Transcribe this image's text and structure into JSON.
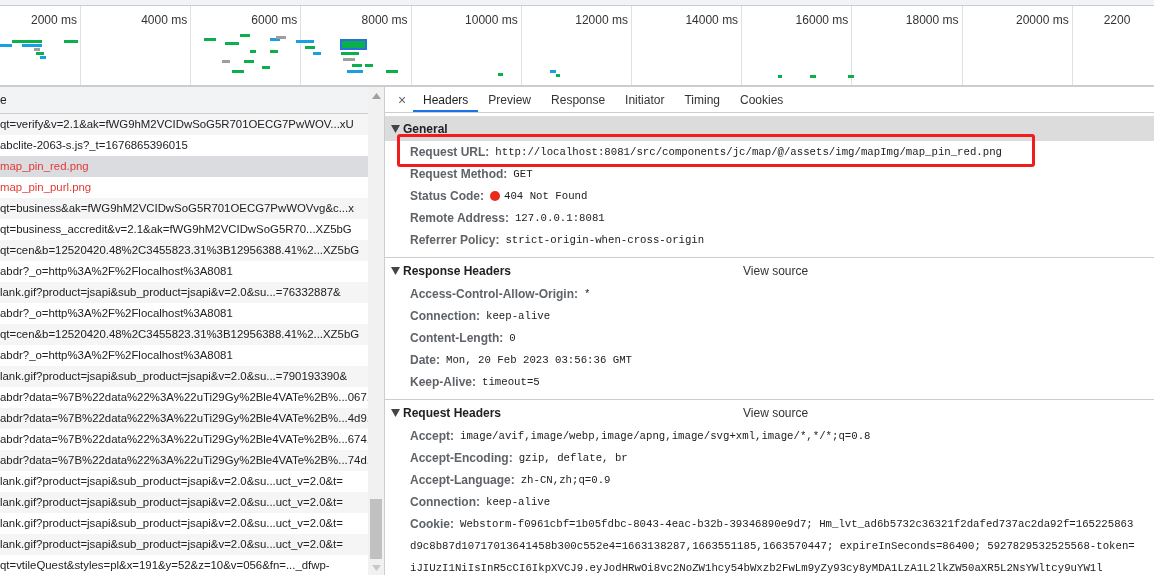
{
  "timeline": {
    "ticks": [
      "2000 ms",
      "4000 ms",
      "6000 ms",
      "8000 ms",
      "10000 ms",
      "12000 ms",
      "14000 ms",
      "16000 ms",
      "18000 ms",
      "20000 ms",
      "2200"
    ]
  },
  "request_list": {
    "column_header": "e",
    "rows": [
      {
        "name": "qt=verify&v=2.1&ak=fWG9hM2VCIDwSoG5R701OECG7PwWOV...xU",
        "selected": false,
        "failed": false
      },
      {
        "name": "abclite-2063-s.js?_t=1676865396015",
        "selected": false,
        "failed": false
      },
      {
        "name": "map_pin_red.png",
        "selected": true,
        "failed": true
      },
      {
        "name": "map_pin_purl.png",
        "selected": false,
        "failed": true
      },
      {
        "name": "qt=business&ak=fWG9hM2VCIDwSoG5R701OECG7PwWOVvg&c...x",
        "selected": false,
        "failed": false
      },
      {
        "name": "qt=business_accredit&v=2.1&ak=fWG9hM2VCIDwSoG5R70...XZ5bG",
        "selected": false,
        "failed": false
      },
      {
        "name": "qt=cen&b=12520420.48%2C3455823.31%3B12956388.41%2...XZ5bG",
        "selected": false,
        "failed": false
      },
      {
        "name": "abdr?_o=http%3A%2F%2Flocalhost%3A8081",
        "selected": false,
        "failed": false
      },
      {
        "name": "lank.gif?product=jsapi&sub_product=jsapi&v=2.0&su...=76332887&",
        "selected": false,
        "failed": false
      },
      {
        "name": "abdr?_o=http%3A%2F%2Flocalhost%3A8081",
        "selected": false,
        "failed": false
      },
      {
        "name": "qt=cen&b=12520420.48%2C3455823.31%3B12956388.41%2...XZ5bG",
        "selected": false,
        "failed": false
      },
      {
        "name": "abdr?_o=http%3A%2F%2Flocalhost%3A8081",
        "selected": false,
        "failed": false
      },
      {
        "name": "lank.gif?product=jsapi&sub_product=jsapi&v=2.0&su...=790193390&",
        "selected": false,
        "failed": false
      },
      {
        "name": "abdr?data=%7B%22data%22%3A%22uTi29Gy%2Ble4VATe%2B%...067.",
        "selected": false,
        "failed": false
      },
      {
        "name": "abdr?data=%7B%22data%22%3A%22uTi29Gy%2Ble4VATe%2B%...4d9.",
        "selected": false,
        "failed": false
      },
      {
        "name": "abdr?data=%7B%22data%22%3A%22uTi29Gy%2Ble4VATe%2B%...674.",
        "selected": false,
        "failed": false
      },
      {
        "name": "abdr?data=%7B%22data%22%3A%22uTi29Gy%2Ble4VATe%2B%...74d.",
        "selected": false,
        "failed": false
      },
      {
        "name": "lank.gif?product=jsapi&sub_product=jsapi&v=2.0&su...uct_v=2.0&t=",
        "selected": false,
        "failed": false
      },
      {
        "name": "lank.gif?product=jsapi&sub_product=jsapi&v=2.0&su...uct_v=2.0&t=",
        "selected": false,
        "failed": false
      },
      {
        "name": "lank.gif?product=jsapi&sub_product=jsapi&v=2.0&su...uct_v=2.0&t=",
        "selected": false,
        "failed": false
      },
      {
        "name": "lank.gif?product=jsapi&sub_product=jsapi&v=2.0&su...uct_v=2.0&t=",
        "selected": false,
        "failed": false
      },
      {
        "name": "qt=vtileQuest&styles=pl&x=191&y=52&z=10&v=056&fn=..._dfwp-",
        "selected": false,
        "failed": false
      }
    ]
  },
  "details": {
    "close_label": "×",
    "tabs": [
      {
        "label": "Headers",
        "selected": true
      },
      {
        "label": "Preview",
        "selected": false
      },
      {
        "label": "Response",
        "selected": false
      },
      {
        "label": "Initiator",
        "selected": false
      },
      {
        "label": "Timing",
        "selected": false
      },
      {
        "label": "Cookies",
        "selected": false
      }
    ],
    "sections": [
      {
        "title": "General",
        "rows": [
          {
            "label": "Request URL:",
            "value": "http://localhost:8081/src/components/jc/map/@/assets/img/mapImg/map_pin_red.png",
            "highlighted": true
          },
          {
            "label": "Request Method:",
            "value": "GET"
          },
          {
            "label": "Status Code:",
            "value": "404 Not Found",
            "error": true
          },
          {
            "label": "Remote Address:",
            "value": "127.0.0.1:8081"
          },
          {
            "label": "Referrer Policy:",
            "value": "strict-origin-when-cross-origin"
          }
        ]
      },
      {
        "title": "Response Headers",
        "view_source": "View source",
        "rows": [
          {
            "label": "Access-Control-Allow-Origin:",
            "value": "*"
          },
          {
            "label": "Connection:",
            "value": "keep-alive"
          },
          {
            "label": "Content-Length:",
            "value": "0"
          },
          {
            "label": "Date:",
            "value": "Mon, 20 Feb 2023 03:56:36 GMT"
          },
          {
            "label": "Keep-Alive:",
            "value": "timeout=5"
          }
        ]
      },
      {
        "title": "Request Headers",
        "view_source": "View source",
        "rows": [
          {
            "label": "Accept:",
            "value": "image/avif,image/webp,image/apng,image/svg+xml,image/*,*/*;q=0.8"
          },
          {
            "label": "Accept-Encoding:",
            "value": "gzip, deflate, br"
          },
          {
            "label": "Accept-Language:",
            "value": "zh-CN,zh;q=0.9"
          },
          {
            "label": "Connection:",
            "value": "keep-alive"
          },
          {
            "label": "Cookie:",
            "value": "Webstorm-f0961cbf=1b05fdbc-8043-4eac-b32b-39346890e9d7; Hm_lvt_ad6b5732c36321f2dafed737ac2da92f=165225863",
            "continuation": [
              "d9c8b87d10717013641458b300c552e4=1663138287,1663551185,1663570447; expireInSeconds=86400; 5927829532525568-token=",
              "iJIUzI1NiIsInR5cCI6IkpXVCJ9.eyJodHRwOi8vc2NoZW1hcy54bWxzb2FwLm9yZy93cy8yMDA1LzA1L2lkZW50aXR5L2NsYWltcy9uYW1l"
            ]
          }
        ]
      }
    ]
  }
}
